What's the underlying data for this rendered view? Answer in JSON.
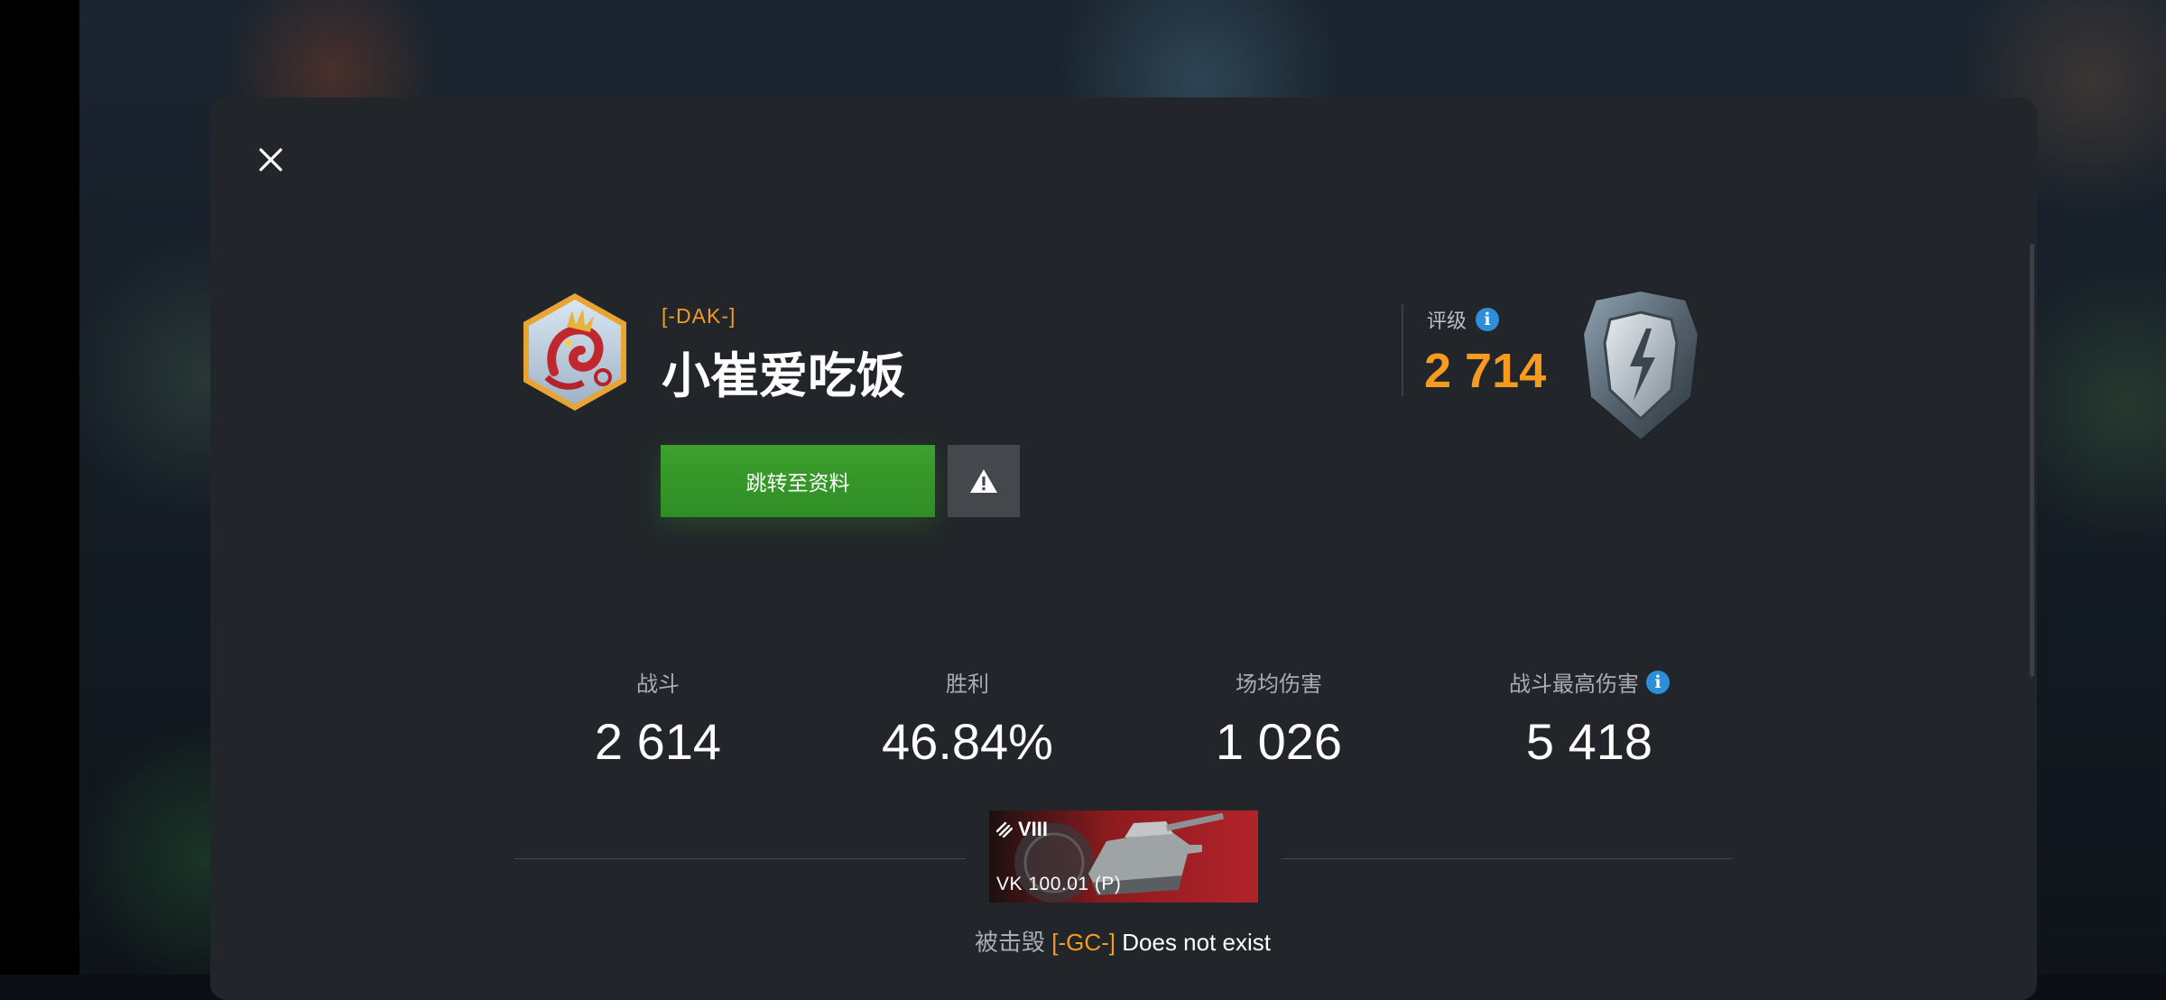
{
  "player": {
    "clan_tag": "[-DAK-]",
    "name": "小崔爱吃饭"
  },
  "buttons": {
    "profile_label": "跳转至资料"
  },
  "rating": {
    "label": "评级",
    "value": "2 714"
  },
  "stats": [
    {
      "label": "战斗",
      "value": "2 614"
    },
    {
      "label": "胜利",
      "value": "46.84%"
    },
    {
      "label": "场均伤害",
      "value": "1 026"
    },
    {
      "label": "战斗最高伤害",
      "value": "5 418"
    }
  ],
  "last_battle": {
    "tank_tier": "VIII",
    "tank_name": "VK 100.01 (P)",
    "killed_by_label": "被击毁",
    "killer_clan": "[-GC-]",
    "killer_name": "Does not exist"
  },
  "colors": {
    "accent_orange": "#f59b1f",
    "button_green": "#3da02d",
    "info_blue": "#2e8fd9",
    "modal_bg": "#22262a"
  },
  "icons": [
    "close-icon",
    "warning-icon",
    "info-icon",
    "shield-rating-icon",
    "dragon-avatar",
    "tank-icon"
  ]
}
